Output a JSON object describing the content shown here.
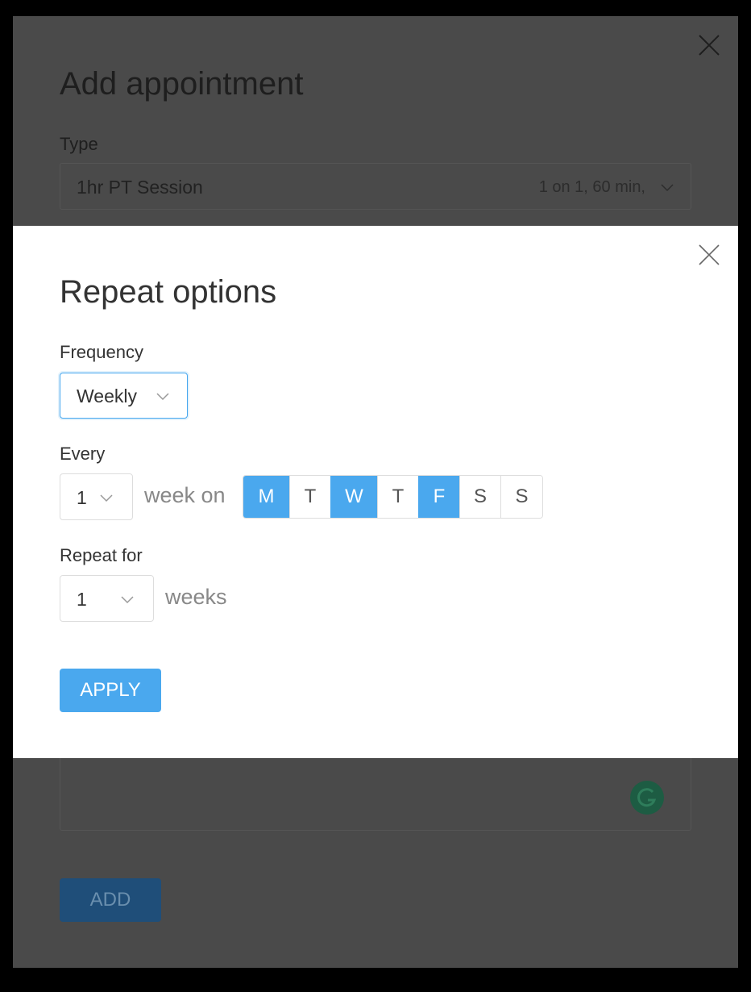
{
  "outer_dialog": {
    "title": "Add appointment",
    "type_label": "Type",
    "type_value": "1hr PT Session",
    "type_meta": "1 on 1, 60 min,",
    "add_label": "ADD"
  },
  "repeat_modal": {
    "title": "Repeat options",
    "frequency_label": "Frequency",
    "frequency_value": "Weekly",
    "every_label": "Every",
    "every_value": "1",
    "week_on_text": "week on",
    "days": [
      {
        "label": "M",
        "selected": true
      },
      {
        "label": "T",
        "selected": false
      },
      {
        "label": "W",
        "selected": true
      },
      {
        "label": "T",
        "selected": false
      },
      {
        "label": "F",
        "selected": true
      },
      {
        "label": "S",
        "selected": false
      },
      {
        "label": "S",
        "selected": false
      }
    ],
    "repeat_for_label": "Repeat for",
    "repeat_for_value": "1",
    "weeks_text": "weeks",
    "apply_label": "APPLY"
  },
  "colors": {
    "accent": "#4aa8ee",
    "overlay": "#4a4a4a"
  }
}
